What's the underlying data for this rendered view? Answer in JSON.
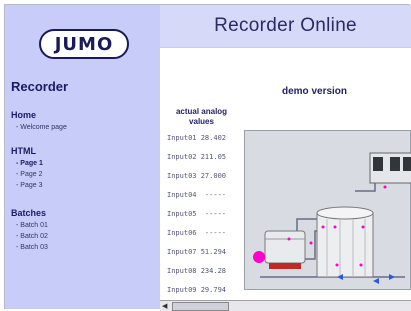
{
  "logo": "JUMO",
  "sidebar": {
    "title": "Recorder",
    "sections": [
      {
        "heading": "Home",
        "items": [
          {
            "label": "- Welcome page"
          }
        ]
      },
      {
        "heading": "HTML",
        "items": [
          {
            "label": "- Page 1",
            "active": true
          },
          {
            "label": "- Page 2"
          },
          {
            "label": "- Page 3"
          }
        ]
      },
      {
        "heading": "Batches",
        "items": [
          {
            "label": "- Batch 01"
          },
          {
            "label": "- Batch 02"
          },
          {
            "label": "- Batch 03"
          }
        ]
      }
    ]
  },
  "header": {
    "title": "Recorder   Online"
  },
  "main": {
    "subtitle": "demo version",
    "values_heading_line1": "actual analog",
    "values_heading_line2": "values",
    "values": [
      "Input01 28.402",
      "Input02 211.05",
      "Input03 27.000",
      "Input04  -----",
      "Input05  -----",
      "Input06  -----",
      "Input07 51.294",
      "Input08 234.28",
      "Input09 29.794"
    ]
  },
  "colors": {
    "sidebar": "#c8ccf8",
    "header": "#d6daf8",
    "accent_magenta": "#ff00cc",
    "text_navy": "#1a1a66"
  }
}
